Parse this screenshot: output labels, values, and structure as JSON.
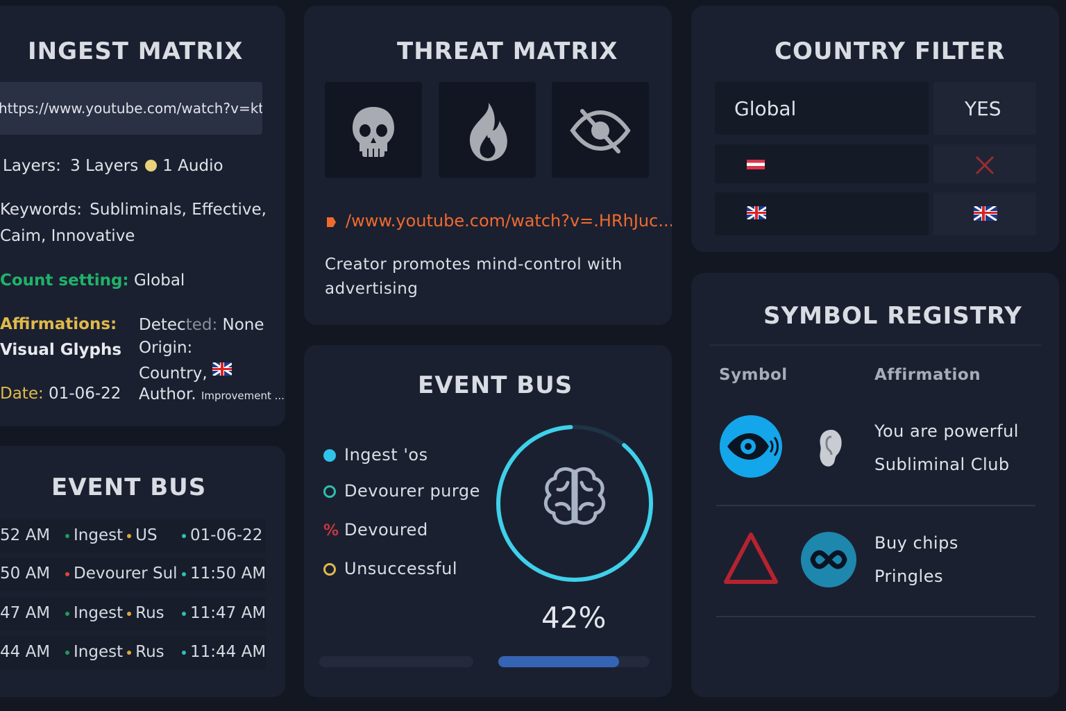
{
  "ingest_matrix": {
    "title": "INGEST MATRIX",
    "url": "https://www.youtube.com/watch?v=ktVb...",
    "layers_label": "Layers:",
    "layers_value": "3 Layers",
    "audio_value": "1 Audio",
    "keywords_label": "Keywords:",
    "keywords_value": "Subliminals, Effective,",
    "keywords_value2": "Caim, Innovative",
    "count_label": "Count setting:",
    "count_value": "Global",
    "affirmations_label": "Affirmations:",
    "affirmations_value": "Visual Glyphs",
    "date_label": "Date:",
    "date_value": "01-06-22",
    "detected_label_a": "Detec",
    "detected_label_b": "ted:",
    "detected_value": "None",
    "origin_label": "Origin:",
    "country_label": "Country,",
    "author_label": "Author.",
    "author_value": "Improvement ..."
  },
  "event_bus_left": {
    "title": "EVENT BUS",
    "rows": [
      {
        "time": "52 AM",
        "event": "Ingest",
        "region": "US",
        "stamp": "01-06-22",
        "event_color": "#1f9a5c",
        "region_color": "#e0a93b"
      },
      {
        "time": "50 AM",
        "event": "Devourer Sul",
        "region": "",
        "stamp": "11:50 AM",
        "event_color": "#e0443a",
        "region_color": ""
      },
      {
        "time": "47 AM",
        "event": "Ingest",
        "region": "Rus",
        "stamp": "11:47 AM",
        "event_color": "#1f9a5c",
        "region_color": "#e0a93b"
      },
      {
        "time": "44 AM",
        "event": "Ingest",
        "region": "Rus",
        "stamp": "11:44 AM",
        "event_color": "#1f9a5c",
        "region_color": "#e0a93b"
      }
    ]
  },
  "threat_matrix": {
    "title": "THREAT MATRIX",
    "tiles": [
      "skull-icon",
      "flame-icon",
      "eye-slash-icon"
    ],
    "url": "/www.youtube.com/watch?v=.HRhJuc...",
    "description": "Creator promotes mind-control with advertising"
  },
  "event_bus_center": {
    "title": "EVENT BUS",
    "legend": [
      {
        "label": "Ingest 'os",
        "marker": "filled",
        "color": "#2fc4ea"
      },
      {
        "label": "Devourer purge",
        "marker": "ring",
        "color": "#2fbfb0"
      },
      {
        "label": "Devoured",
        "marker": "percent",
        "color": "#c4383e"
      },
      {
        "label": "Unsuccessful",
        "marker": "ring",
        "color": "#e0b94b"
      }
    ],
    "progress_percent": 42,
    "progress_label": "42%",
    "bar2_fill": 0.8,
    "accent": "#3fd0ea"
  },
  "country_filter": {
    "title": "COUNTRY FILTER",
    "rows": [
      {
        "left": "Global",
        "right": "YES"
      },
      {
        "left_icon": "austria-flag",
        "right_icon": "x-icon"
      },
      {
        "left_icon": "uk-flag",
        "right_icon": "uk-flag"
      }
    ]
  },
  "symbol_registry": {
    "title": "SYMBOL REGISTRY",
    "col_symbol": "Symbol",
    "col_affirmation": "Affirmation",
    "entries": [
      {
        "icons": [
          "eye-sound-icon",
          "ear-icon"
        ],
        "lines": [
          "You are powerful",
          "Subliminal Club"
        ]
      },
      {
        "icons": [
          "triangle-icon",
          "infinity-icon"
        ],
        "lines": [
          "Buy chips",
          "Pringles"
        ]
      }
    ]
  }
}
